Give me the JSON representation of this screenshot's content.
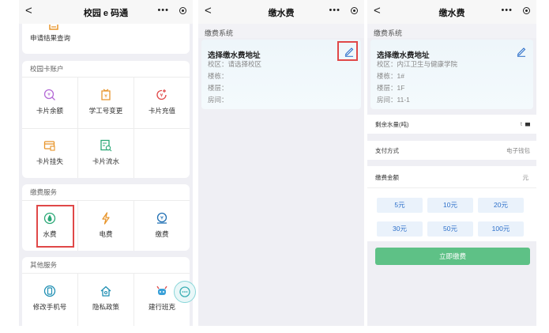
{
  "panel1": {
    "nav": {
      "back": "<",
      "title": "校园 e 码通",
      "more": "•••"
    },
    "top_item": "申请结果查询",
    "card_account": {
      "title": "校园卡账户",
      "items": [
        {
          "label": "卡片余额",
          "icon": "balance-icon"
        },
        {
          "label": "学工号变更",
          "icon": "id-change-icon"
        },
        {
          "label": "卡片充值",
          "icon": "recharge-icon"
        },
        {
          "label": "卡片挂失",
          "icon": "card-loss-icon"
        },
        {
          "label": "卡片流水",
          "icon": "card-records-icon"
        }
      ]
    },
    "card_payment": {
      "title": "缴费服务",
      "items": [
        {
          "label": "水费",
          "icon": "water-drop-icon"
        },
        {
          "label": "电费",
          "icon": "lightning-icon"
        },
        {
          "label": "缴费",
          "icon": "payment-icon"
        }
      ]
    },
    "card_other": {
      "title": "其他服务",
      "items": [
        {
          "label": "修改手机号",
          "icon": "phone-icon"
        },
        {
          "label": "隐私政策",
          "icon": "home-icon"
        },
        {
          "label": "建行班克",
          "icon": "robot-icon"
        }
      ]
    }
  },
  "panel2": {
    "nav": {
      "back": "<",
      "title": "缴水费",
      "more": "•••"
    },
    "section": "缴费系统",
    "address": {
      "title": "选择缴水费地址",
      "campus": "校区：请选择校区",
      "building": "楼栋：",
      "floor": "楼层：",
      "room": "房间："
    }
  },
  "panel3": {
    "nav": {
      "back": "<",
      "title": "缴水费",
      "more": "•••"
    },
    "section": "缴费系统",
    "address": {
      "title": "选择缴水费地址",
      "campus": "校区：内江卫生与健康学院",
      "building": "楼栋：1#",
      "floor": "楼层：1F",
      "room": "房间：11-1"
    },
    "remaining_label": "剩余水量(吨)",
    "remaining_value": "t",
    "pay_method_label": "支付方式",
    "pay_method_value": "电子钱包",
    "amount_label": "缴费金额",
    "amount_unit": "元",
    "options": [
      "5元",
      "10元",
      "20元",
      "30元",
      "50元",
      "100元"
    ],
    "pay_button": "立即缴费"
  },
  "colors": {
    "highlight": "#e04848",
    "accent": "#2c6fc9",
    "pay": "#5ec186",
    "icon_orange": "#e8952b",
    "icon_purple": "#b46ad6",
    "icon_green": "#2aa876"
  }
}
